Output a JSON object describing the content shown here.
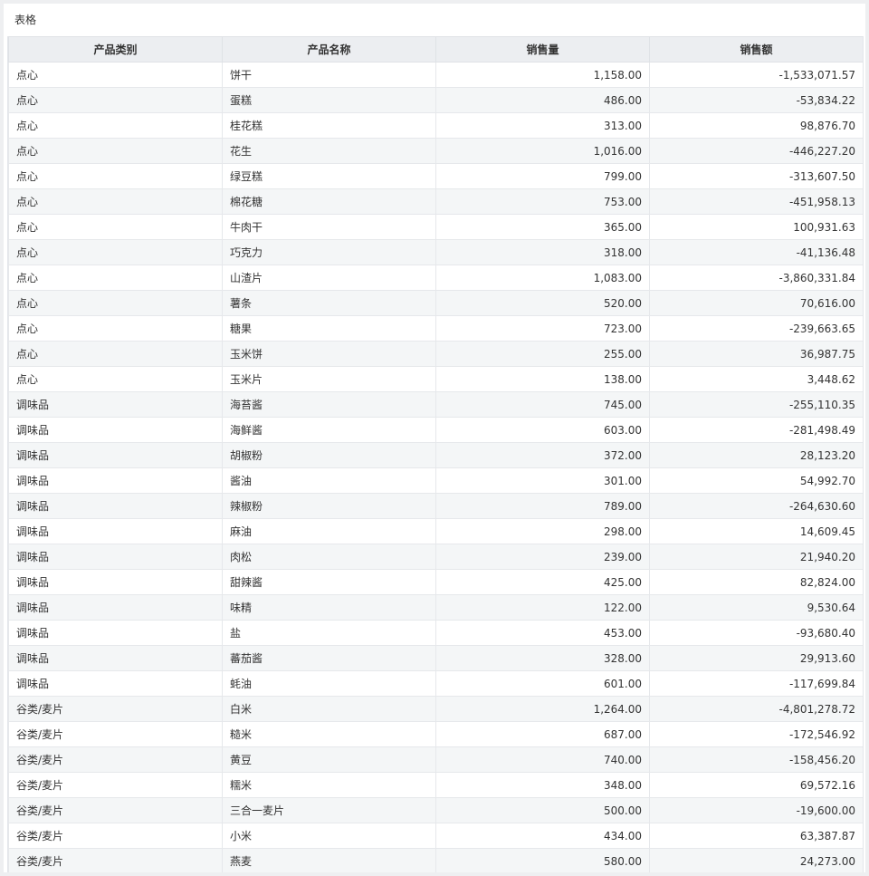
{
  "panel": {
    "title": "表格"
  },
  "table": {
    "columns": [
      "产品类别",
      "产品名称",
      "销售量",
      "销售额"
    ],
    "rows": [
      [
        "点心",
        "饼干",
        "1,158.00",
        "-1,533,071.57"
      ],
      [
        "点心",
        "蛋糕",
        "486.00",
        "-53,834.22"
      ],
      [
        "点心",
        "桂花糕",
        "313.00",
        "98,876.70"
      ],
      [
        "点心",
        "花生",
        "1,016.00",
        "-446,227.20"
      ],
      [
        "点心",
        "绿豆糕",
        "799.00",
        "-313,607.50"
      ],
      [
        "点心",
        "棉花糖",
        "753.00",
        "-451,958.13"
      ],
      [
        "点心",
        "牛肉干",
        "365.00",
        "100,931.63"
      ],
      [
        "点心",
        "巧克力",
        "318.00",
        "-41,136.48"
      ],
      [
        "点心",
        "山渣片",
        "1,083.00",
        "-3,860,331.84"
      ],
      [
        "点心",
        "薯条",
        "520.00",
        "70,616.00"
      ],
      [
        "点心",
        "糖果",
        "723.00",
        "-239,663.65"
      ],
      [
        "点心",
        "玉米饼",
        "255.00",
        "36,987.75"
      ],
      [
        "点心",
        "玉米片",
        "138.00",
        "3,448.62"
      ],
      [
        "调味品",
        "海苔酱",
        "745.00",
        "-255,110.35"
      ],
      [
        "调味品",
        "海鲜酱",
        "603.00",
        "-281,498.49"
      ],
      [
        "调味品",
        "胡椒粉",
        "372.00",
        "28,123.20"
      ],
      [
        "调味品",
        "酱油",
        "301.00",
        "54,992.70"
      ],
      [
        "调味品",
        "辣椒粉",
        "789.00",
        "-264,630.60"
      ],
      [
        "调味品",
        "麻油",
        "298.00",
        "14,609.45"
      ],
      [
        "调味品",
        "肉松",
        "239.00",
        "21,940.20"
      ],
      [
        "调味品",
        "甜辣酱",
        "425.00",
        "82,824.00"
      ],
      [
        "调味品",
        "味精",
        "122.00",
        "9,530.64"
      ],
      [
        "调味品",
        "盐",
        "453.00",
        "-93,680.40"
      ],
      [
        "调味品",
        "蕃茄酱",
        "328.00",
        "29,913.60"
      ],
      [
        "调味品",
        "蚝油",
        "601.00",
        "-117,699.84"
      ],
      [
        "谷类/麦片",
        "白米",
        "1,264.00",
        "-4,801,278.72"
      ],
      [
        "谷类/麦片",
        "糙米",
        "687.00",
        "-172,546.92"
      ],
      [
        "谷类/麦片",
        "黄豆",
        "740.00",
        "-158,456.20"
      ],
      [
        "谷类/麦片",
        "糯米",
        "348.00",
        "69,572.16"
      ],
      [
        "谷类/麦片",
        "三合一麦片",
        "500.00",
        "-19,600.00"
      ],
      [
        "谷类/麦片",
        "小米",
        "434.00",
        "63,387.87"
      ],
      [
        "谷类/麦片",
        "燕麦",
        "580.00",
        "24,273.00"
      ]
    ]
  }
}
